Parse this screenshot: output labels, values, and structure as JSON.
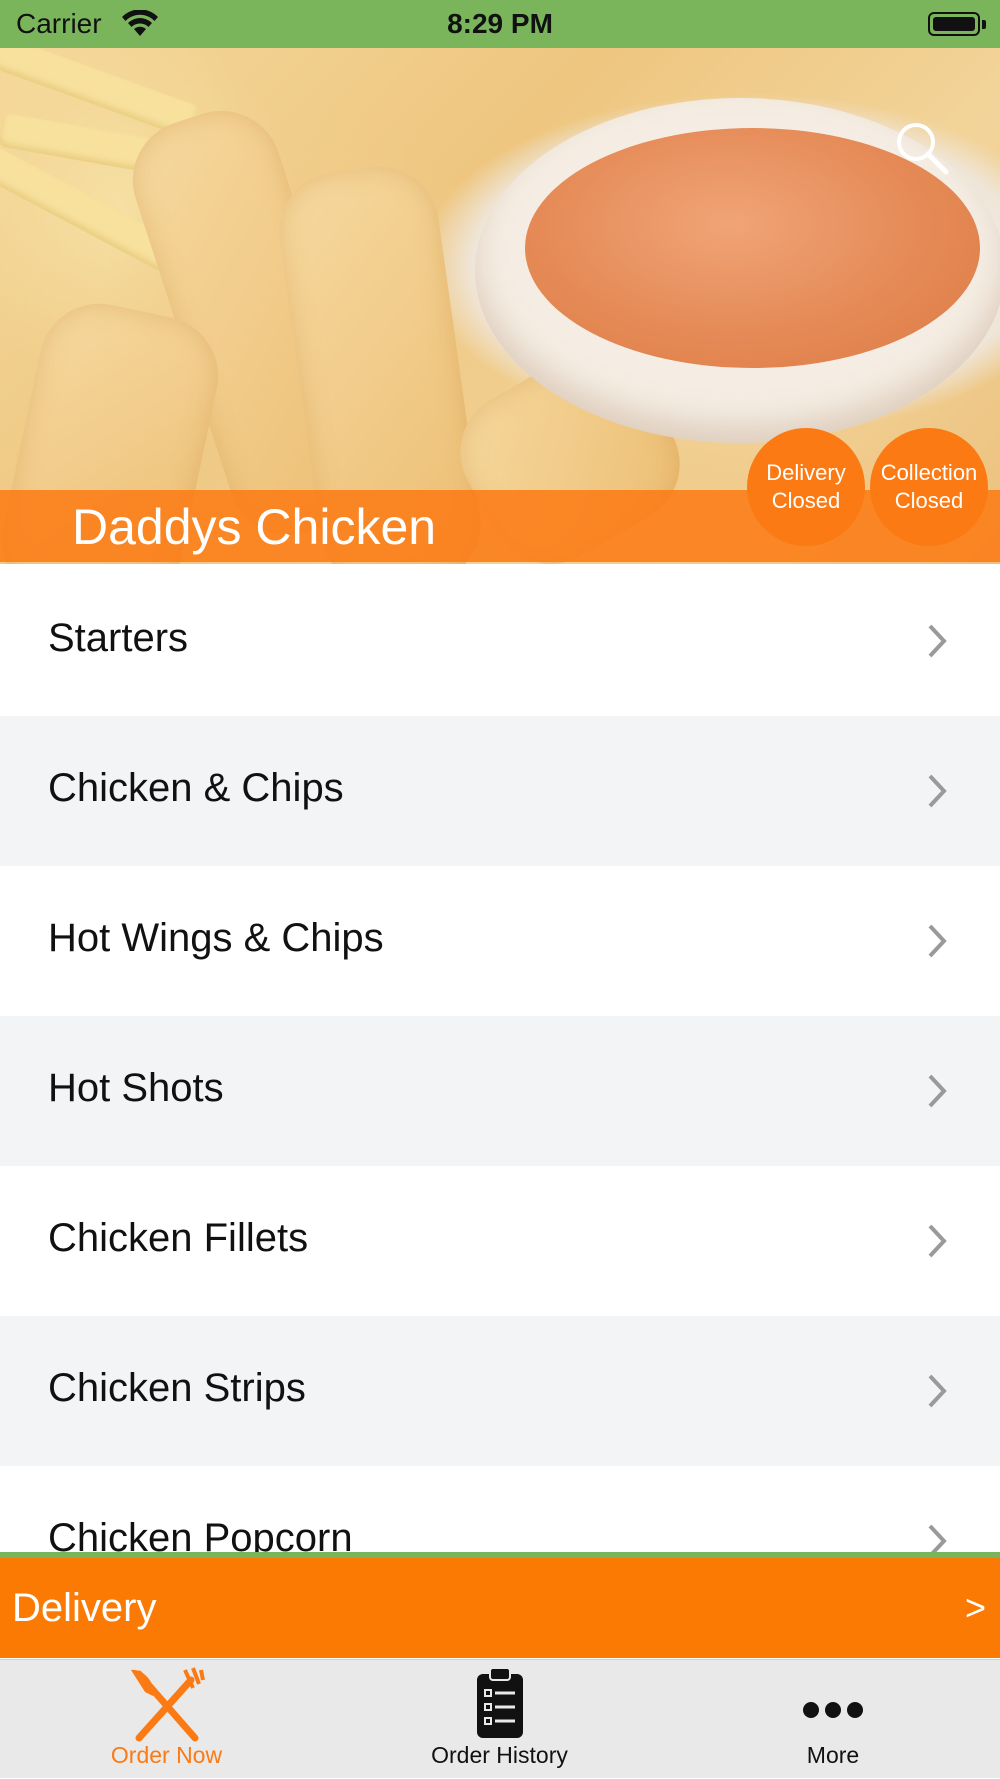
{
  "status_bar": {
    "carrier": "Carrier",
    "time": "8:29 PM"
  },
  "hero": {
    "restaurant_name": "Daddys Chicken",
    "delivery_status": {
      "line1": "Delivery",
      "line2": "Closed"
    },
    "collection_status": {
      "line1": "Collection",
      "line2": "Closed"
    },
    "icon": "search-icon"
  },
  "menu": {
    "items": [
      {
        "label": "Starters"
      },
      {
        "label": "Chicken & Chips"
      },
      {
        "label": "Hot Wings & Chips"
      },
      {
        "label": "Hot Shots"
      },
      {
        "label": "Chicken Fillets"
      },
      {
        "label": "Chicken Strips"
      },
      {
        "label": "Chicken Popcorn"
      }
    ]
  },
  "order_type_bar": {
    "label": "Delivery",
    "arrow": ">"
  },
  "tab_bar": {
    "tabs": [
      {
        "label": "Order Now",
        "icon": "fork-knife-icon",
        "active": true
      },
      {
        "label": "Order History",
        "icon": "clipboard-icon",
        "active": false
      },
      {
        "label": "More",
        "icon": "more-dots-icon",
        "active": false
      }
    ]
  },
  "colors": {
    "accent": "#fb7a14",
    "status_bar": "#7ab55c",
    "tab_bar": "#e9e9ea",
    "row_alt": "#f3f4f6"
  }
}
